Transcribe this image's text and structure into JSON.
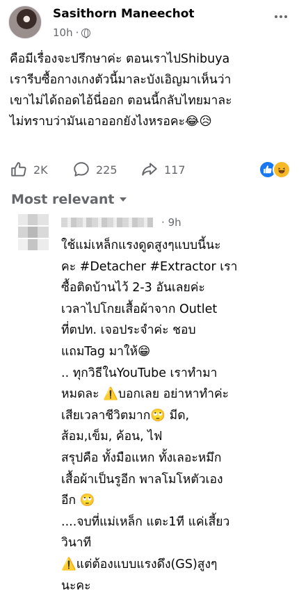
{
  "post": {
    "author": "Sasithorn Maneechot",
    "time": "10h",
    "privacy_sep": "·",
    "lines": [
      "คือมีเรื่องจะปรึกษาค่ะ ตอนเราไปShibuya",
      "เรารีบซื้อกางเกงตัวนี้มาละบังเอิญมาเห็นว่า",
      "เขาไม่ได้ถอดไอ้นี่ออก ตอนนี้กลับไทยมาละ",
      "ไม่ทราบว่ามันเอาออกยังไงหรอคะ😂😥"
    ]
  },
  "actions": {
    "likes": "2K",
    "comments": "225",
    "shares": "117"
  },
  "sort_label": "Most relevant",
  "comment": {
    "time_sep": "·",
    "time": "9h",
    "lines": [
      "ใช้แม่เหล็กแรงดูดสูงๆแบบนี้นะ",
      "คะ #Detacher #Extractor เรา",
      "ซื้อติดบ้านไว้ 2-3 อันเลยค่ะ",
      "เวลาไปโกยเสื้อผ้าจาก Outlet",
      "ที่ตปท. เจอประจำค่ะ ชอบ",
      "แถมTag มาให้😁",
      ".. ทุกวิธีในYouTube เราทำมา",
      "หมดละ ⚠️บอกเลย อย่าหาทำค่ะ",
      "เสียเวลาชีวิตมาก🙄 มีด,",
      "ส้อม,เข็ม, ค้อน, ไฟ",
      "สรุปคือ ทั้งมือแหก ทั้งเลอะหมึก",
      "เสื้อผ้าเป็นรูอีก พาลโมโหตัวเอง",
      "อีก 🙄",
      "....จบที่แม่เหล็ก แตะ1ที แค่เสี้ยว",
      "วินาที",
      "⚠️แต่ต้องแบบแรงดึง(GS)สูงๆ",
      "นะคะ"
    ]
  },
  "icons": {
    "like": "thumbs-up-icon",
    "comment": "comment-bubble-icon",
    "share": "share-arrow-icon",
    "more": "more-horizontal-icon",
    "privacy": "globe-icon",
    "sort": "caret-down-icon"
  },
  "colors": {
    "accent": "#1877f2",
    "secondary_text": "#65676b",
    "primary_text": "#050505"
  }
}
